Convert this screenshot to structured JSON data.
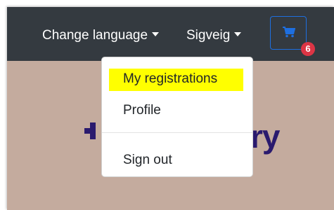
{
  "navbar": {
    "language_label": "Change language",
    "user_label": "Sigveig",
    "cart_badge": "6"
  },
  "logo": {
    "text_fragment": "ry"
  },
  "dropdown": {
    "items": [
      {
        "label": "My registrations",
        "highlighted": true
      },
      {
        "label": "Profile"
      },
      {
        "label": "Sign out"
      }
    ]
  },
  "colors": {
    "navbar_bg": "#343a40",
    "page_bg": "#c4ab9e",
    "cart_border": "#1e6fe0",
    "badge": "#dc3545",
    "highlight": "#ffff00",
    "logo": "#2a1a6e"
  },
  "icons": {
    "cart": "shopping-cart-icon",
    "caret": "caret-down-icon"
  }
}
